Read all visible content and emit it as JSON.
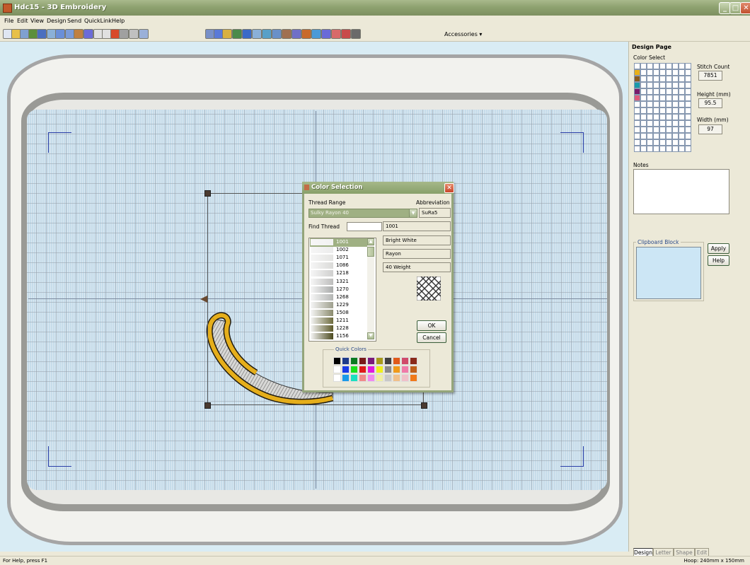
{
  "window": {
    "title": "Hdc15 - 3D Embroidery",
    "minimize": "_",
    "maximize": "□",
    "close": "✕"
  },
  "menu": [
    "File",
    "Edit",
    "View",
    "Design",
    "Send",
    "QuickLink",
    "Help"
  ],
  "toolbar": {
    "accessories_label": "Accessories ▾"
  },
  "right_panel": {
    "title": "Design Page",
    "color_select_label": "Color Select",
    "stitch_count_label": "Stitch Count",
    "stitch_count": "7851",
    "height_label": "Height (mm)",
    "height": "95.5",
    "width_label": "Width (mm)",
    "width": "97",
    "notes_label": "Notes",
    "clipboard_label": "Clipboard Block",
    "apply_label": "Apply",
    "help_label": "Help",
    "design_colors": [
      "#ffffff",
      "#e8b018",
      "#8a5a1c",
      "#1a9aa8",
      "#7a1a6a",
      "#e05a7a"
    ]
  },
  "tabs": [
    "Design",
    "Letter",
    "Shape",
    "Edit"
  ],
  "status": {
    "left": "For Help, press F1",
    "right": "Hoop: 240mm x 150mm"
  },
  "dialog": {
    "title": "Color Selection",
    "close": "✕",
    "thread_range_label": "Thread Range",
    "abbreviation_label": "Abbreviation",
    "thread_range_value": "Sulky Rayon 40",
    "abbreviation_value": "SuRa5",
    "find_thread_label": "Find Thread",
    "find_thread_value": "",
    "selected_code": "1001",
    "selected_name": "Bright White",
    "material": "Rayon",
    "weight": "40 Weight",
    "ok_label": "OK",
    "cancel_label": "Cancel",
    "quick_colors_label": "Quick Colors",
    "threads": [
      {
        "code": "1001",
        "color": "#f2f2f2"
      },
      {
        "code": "1002",
        "color": "#ececec"
      },
      {
        "code": "1071",
        "color": "#e4e4e2"
      },
      {
        "code": "1086",
        "color": "#dadad8"
      },
      {
        "code": "1218",
        "color": "#cfcfce"
      },
      {
        "code": "1321",
        "color": "#bdbdbc"
      },
      {
        "code": "1270",
        "color": "#a8aaa9"
      },
      {
        "code": "1268",
        "color": "#b4b6b4"
      },
      {
        "code": "1229",
        "color": "#9fa08e"
      },
      {
        "code": "1508",
        "color": "#8b8b6e"
      },
      {
        "code": "1211",
        "color": "#6d6b3d"
      },
      {
        "code": "1228",
        "color": "#5d5a2a"
      },
      {
        "code": "1156",
        "color": "#4c4a1e"
      }
    ],
    "quick_colors": [
      [
        "#000000",
        "#1e3a8a",
        "#0a7a20",
        "#7a1a1a",
        "#7a1a7a",
        "#a89a1a",
        "#404040",
        "#e05a1a",
        "#d04a6a",
        "#8a2a1a"
      ],
      [
        "#ffffff",
        "#1a3ae8",
        "#1ae01a",
        "#e01a1a",
        "#e01ae0",
        "#f0f01a",
        "#8a8a8a",
        "#f09a1a",
        "#f07aa8",
        "#c0601a"
      ],
      [
        "#ffffff",
        "#1a9ae8",
        "#1ae0c0",
        "#f08a8a",
        "#f08af0",
        "#f0f0a0",
        "#c8c8c8",
        "#f0c08a",
        "#f0c0c8",
        "#f07a1a"
      ]
    ]
  }
}
